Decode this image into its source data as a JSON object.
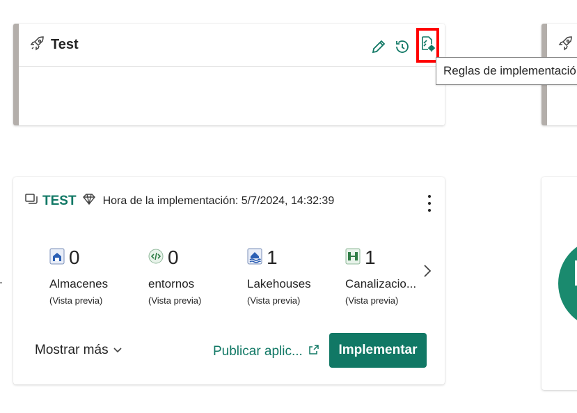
{
  "stage": {
    "title": "Test",
    "actions": {
      "edit": "pencil-icon",
      "history": "history-icon",
      "rules": "deployment-rules-icon"
    }
  },
  "tooltip": {
    "text": "Reglas de implementación"
  },
  "deployment": {
    "name": "TEST",
    "time_text": "Hora de la implementación: 5/7/2024, 14:32:39",
    "metrics": [
      {
        "count": "0",
        "label": "Almacenes",
        "sub": "(Vista previa)",
        "icon": "warehouse-icon"
      },
      {
        "count": "0",
        "label": "entornos",
        "sub": "(Vista previa)",
        "icon": "environment-icon"
      },
      {
        "count": "1",
        "label": "Lakehouses",
        "sub": "(Vista previa)",
        "icon": "lakehouse-icon"
      },
      {
        "count": "1",
        "label": "Canalizacio...",
        "sub": "(Vista previa)",
        "icon": "pipeline-icon"
      }
    ],
    "show_more": "Mostrar más",
    "publish_link": "Publicar aplic...",
    "deploy_button": "Implementar"
  },
  "colors": {
    "accent": "#117865",
    "stage_bar": "#b3aeaa",
    "highlight": "#ff0000"
  }
}
